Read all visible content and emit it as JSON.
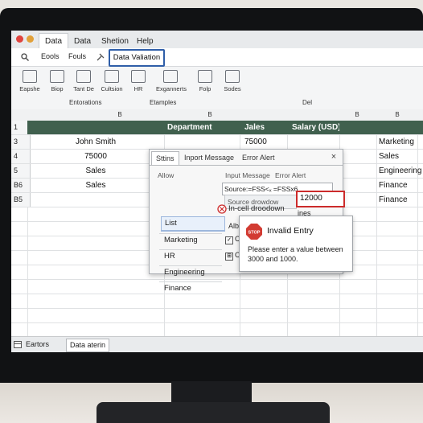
{
  "window": {
    "tabs": [
      "Data",
      "Data",
      "Shetion",
      "Help"
    ]
  },
  "menu": {
    "items": [
      "Eools",
      "Fouls",
      "Data Valiation"
    ]
  },
  "ribbon": {
    "buttons": [
      "Eapshe",
      "Biop",
      "Tant De",
      "Cultsion",
      "HR",
      "Exgannerts",
      "Folp",
      "Sodes"
    ],
    "groups": [
      "Entorations",
      "Etamples",
      "Del"
    ]
  },
  "sheet": {
    "column_headers": [
      "B",
      "B",
      "B",
      "B"
    ],
    "rows": [
      {
        "num": "1",
        "b": "",
        "dept": "Department",
        "sales": "Jales",
        "salary": "Salary (USD)",
        "right": ""
      },
      {
        "num": "3",
        "b": "John Smith",
        "dept": "",
        "sales": "75000",
        "salary": "",
        "right": "Marketing"
      },
      {
        "num": "4",
        "b": "75000",
        "dept": "",
        "sales": "",
        "salary": "",
        "right": "Sales"
      },
      {
        "num": "5",
        "b": "Sales",
        "dept": "",
        "sales": "",
        "salary": "",
        "right": "Engineering"
      },
      {
        "num": "B6",
        "b": "Sales",
        "dept": "",
        "sales": "",
        "salary": "",
        "right": "Finance"
      },
      {
        "num": "B5",
        "b": "",
        "dept": "",
        "sales": "",
        "salary": "",
        "right": "Finance"
      }
    ]
  },
  "dialog": {
    "tabs": [
      "Sttins",
      "Inport Message",
      "Error Alert"
    ],
    "close": "×",
    "allow_label": "Allow",
    "allow_options": [
      "List",
      "Marketing",
      "HR",
      "Engineering",
      "Finance"
    ],
    "mid_labels": [
      "Input Message",
      "Error Alert"
    ],
    "source_field": "Source:=FSS<ₓ =FSSx6",
    "source_dropdown": "Source drowdow",
    "in_cell_dropdown": "In-cell droodown",
    "value": "12000",
    "partial_text": "ines",
    "partial_alb": "Alb",
    "partial_c1": "C",
    "partial_c2": "C"
  },
  "error_popup": {
    "title": "Invalid Entry",
    "message": "Please enter a value between 3000 and 1000.",
    "icon_text": "STOP"
  },
  "statusbar": {
    "tabs": [
      "Eartors",
      "Data aterin"
    ]
  },
  "colors": {
    "header_band": "#40604e",
    "accent_blue": "#2f5ea8",
    "error_red": "#cc2b2b"
  }
}
